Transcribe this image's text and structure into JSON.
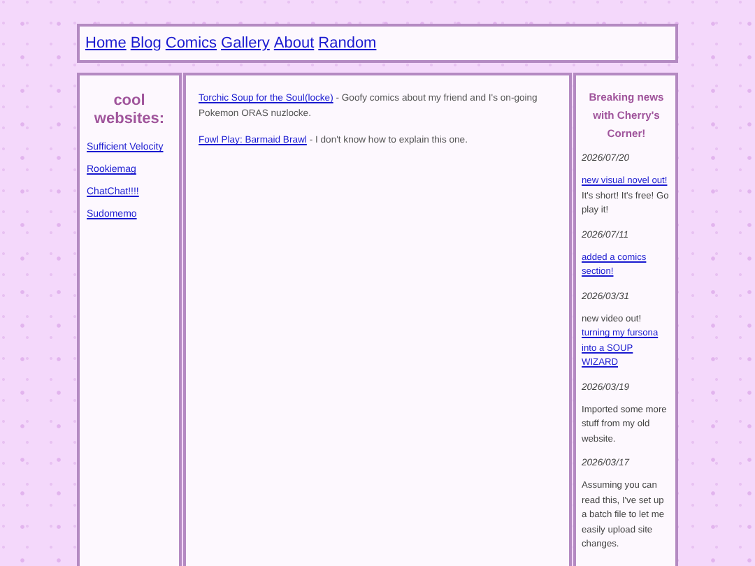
{
  "nav": [
    {
      "label": "Home"
    },
    {
      "label": "Blog"
    },
    {
      "label": "Comics"
    },
    {
      "label": "Gallery"
    },
    {
      "label": "About"
    },
    {
      "label": "Random"
    }
  ],
  "sidebar": {
    "title": "cool websites:",
    "links": [
      {
        "label": "Sufficient Velocity"
      },
      {
        "label": "Rookiemag"
      },
      {
        "label": "ChatChat!!!!"
      },
      {
        "label": "Sudomemo"
      }
    ]
  },
  "comics": [
    {
      "title": "Torchic Soup for the Soul(locke)",
      "description": "- Goofy comics about my friend and I's on-going Pokemon ORAS nuzlocke."
    },
    {
      "title": "Fowl Play: Barmaid Brawl",
      "description": "- I don't know how to explain this one."
    }
  ],
  "news": {
    "title": "Breaking news with Cherry's Corner!",
    "entries": [
      {
        "date": "2026/07/20",
        "parts": [
          {
            "kind": "link",
            "text": "new visual novel out!"
          },
          {
            "kind": "text",
            "text": "It's short! It's free! Go play it!"
          }
        ]
      },
      {
        "date": "2026/07/11",
        "parts": [
          {
            "kind": "link",
            "text": "added a comics section!"
          }
        ]
      },
      {
        "date": "2026/03/31",
        "parts": [
          {
            "kind": "text",
            "text": "new video out!"
          },
          {
            "kind": "link",
            "text": "turning my fursona into a SOUP WIZARD"
          }
        ]
      },
      {
        "date": "2026/03/19",
        "parts": [
          {
            "kind": "text",
            "text": "Imported some more stuff from my old website."
          }
        ]
      },
      {
        "date": "2026/03/17",
        "parts": [
          {
            "kind": "text",
            "text": "Assuming you can read this, I've set up a batch file to let me easily upload site changes."
          }
        ]
      }
    ]
  }
}
